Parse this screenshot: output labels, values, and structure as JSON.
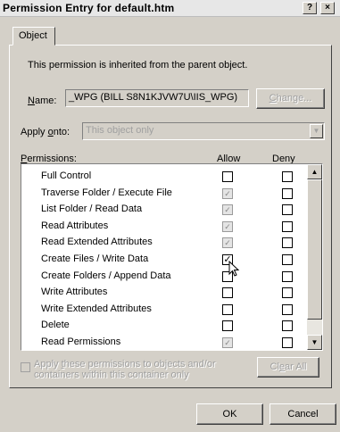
{
  "window": {
    "title": "Permission Entry for default.htm",
    "help_btn": "?",
    "close_btn": "×"
  },
  "tabs": [
    {
      "label": "Object"
    }
  ],
  "info_text": "This permission is inherited from the parent object.",
  "name": {
    "label_prefix": "N",
    "label_rest": "ame:",
    "value": "_WPG (BILL S8N1KJVW7U\\IIS_WPG)",
    "change_btn_prefix": "C",
    "change_btn_rest": "hange..."
  },
  "apply_onto": {
    "label_prefix": "Apply ",
    "label_underlined": "o",
    "label_rest": "nto:",
    "value": "This object only"
  },
  "permissions": {
    "label_prefix": "P",
    "label_rest": "ermissions:",
    "allow_header": "Allow",
    "deny_header": "Deny",
    "rows": [
      {
        "name": "Full Control",
        "allow": "unchecked",
        "deny": "unchecked"
      },
      {
        "name": "Traverse Folder / Execute File",
        "allow": "inherited",
        "deny": "unchecked"
      },
      {
        "name": "List Folder / Read Data",
        "allow": "inherited",
        "deny": "unchecked"
      },
      {
        "name": "Read Attributes",
        "allow": "inherited",
        "deny": "unchecked"
      },
      {
        "name": "Read Extended Attributes",
        "allow": "inherited",
        "deny": "unchecked"
      },
      {
        "name": "Create Files / Write Data",
        "allow": "checked",
        "deny": "unchecked"
      },
      {
        "name": "Create Folders / Append Data",
        "allow": "unchecked",
        "deny": "unchecked"
      },
      {
        "name": "Write Attributes",
        "allow": "unchecked",
        "deny": "unchecked"
      },
      {
        "name": "Write Extended Attributes",
        "allow": "unchecked",
        "deny": "unchecked"
      },
      {
        "name": "Delete",
        "allow": "unchecked",
        "deny": "unchecked"
      },
      {
        "name": "Read Permissions",
        "allow": "inherited",
        "deny": "unchecked"
      }
    ]
  },
  "propagate": {
    "label_prefix": "Apply ",
    "label_underlined": "t",
    "label_rest": "hese permissions to objects and/or containers within this container only"
  },
  "clear_all": {
    "prefix": "Cl",
    "underlined": "e",
    "rest": "ar All"
  },
  "footer": {
    "ok": "OK",
    "cancel": "Cancel"
  }
}
